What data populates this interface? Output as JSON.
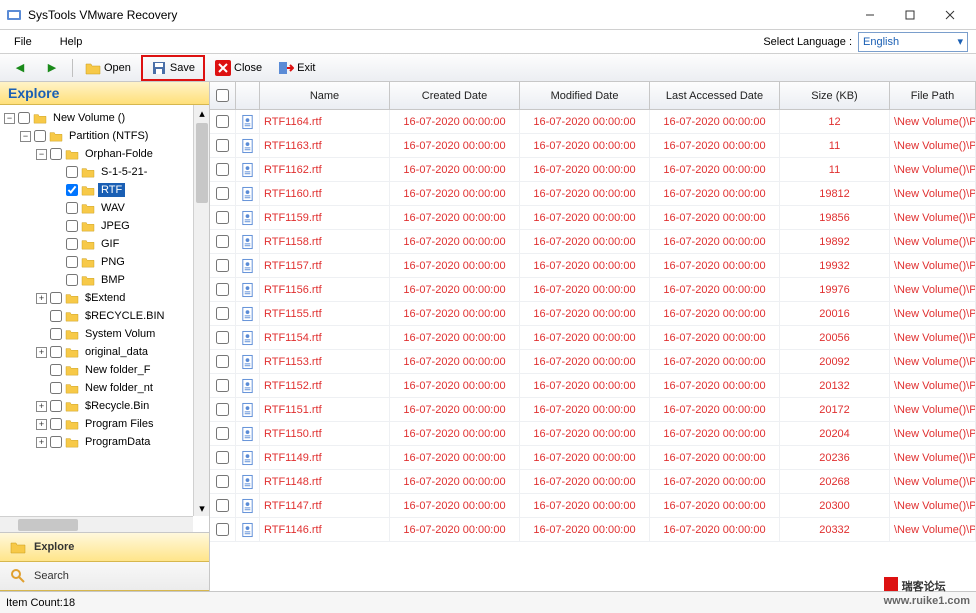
{
  "title": "SysTools VMware Recovery",
  "menu": {
    "file": "File",
    "help": "Help",
    "lang_label": "Select Language :",
    "lang_value": "English"
  },
  "toolbar": {
    "open": "Open",
    "save": "Save",
    "close": "Close",
    "exit": "Exit"
  },
  "explore_header": "Explore",
  "nav": {
    "explore": "Explore",
    "search": "Search"
  },
  "tree": {
    "root": "New Volume ()",
    "partition": "Partition (NTFS)",
    "orphan": "Orphan-Folde",
    "sid": "S-1-5-21-",
    "rtf": "RTF",
    "wav": "WAV",
    "jpeg": "JPEG",
    "gif": "GIF",
    "png": "PNG",
    "bmp": "BMP",
    "extend": "$Extend",
    "recycle": "$RECYCLE.BIN",
    "sysvol": "System Volum",
    "orig": "original_data",
    "nf1": "New folder_F",
    "nf2": "New folder_nt",
    "recbin": "$Recycle.Bin",
    "pf": "Program Files",
    "pd": "ProgramData"
  },
  "columns": {
    "name": "Name",
    "created": "Created Date",
    "modified": "Modified Date",
    "accessed": "Last Accessed Date",
    "size": "Size (KB)",
    "path": "File Path"
  },
  "rows": [
    {
      "name": "RTF1164.rtf",
      "created": "16-07-2020 00:00:00",
      "modified": "16-07-2020 00:00:00",
      "accessed": "16-07-2020 00:00:00",
      "size": "12",
      "path": "\\New Volume()\\Partiti..."
    },
    {
      "name": "RTF1163.rtf",
      "created": "16-07-2020 00:00:00",
      "modified": "16-07-2020 00:00:00",
      "accessed": "16-07-2020 00:00:00",
      "size": "11",
      "path": "\\New Volume()\\Partiti..."
    },
    {
      "name": "RTF1162.rtf",
      "created": "16-07-2020 00:00:00",
      "modified": "16-07-2020 00:00:00",
      "accessed": "16-07-2020 00:00:00",
      "size": "11",
      "path": "\\New Volume()\\Partiti..."
    },
    {
      "name": "RTF1160.rtf",
      "created": "16-07-2020 00:00:00",
      "modified": "16-07-2020 00:00:00",
      "accessed": "16-07-2020 00:00:00",
      "size": "19812",
      "path": "\\New Volume()\\Partiti..."
    },
    {
      "name": "RTF1159.rtf",
      "created": "16-07-2020 00:00:00",
      "modified": "16-07-2020 00:00:00",
      "accessed": "16-07-2020 00:00:00",
      "size": "19856",
      "path": "\\New Volume()\\Partiti..."
    },
    {
      "name": "RTF1158.rtf",
      "created": "16-07-2020 00:00:00",
      "modified": "16-07-2020 00:00:00",
      "accessed": "16-07-2020 00:00:00",
      "size": "19892",
      "path": "\\New Volume()\\Partiti..."
    },
    {
      "name": "RTF1157.rtf",
      "created": "16-07-2020 00:00:00",
      "modified": "16-07-2020 00:00:00",
      "accessed": "16-07-2020 00:00:00",
      "size": "19932",
      "path": "\\New Volume()\\Partiti..."
    },
    {
      "name": "RTF1156.rtf",
      "created": "16-07-2020 00:00:00",
      "modified": "16-07-2020 00:00:00",
      "accessed": "16-07-2020 00:00:00",
      "size": "19976",
      "path": "\\New Volume()\\Partiti..."
    },
    {
      "name": "RTF1155.rtf",
      "created": "16-07-2020 00:00:00",
      "modified": "16-07-2020 00:00:00",
      "accessed": "16-07-2020 00:00:00",
      "size": "20016",
      "path": "\\New Volume()\\Partiti..."
    },
    {
      "name": "RTF1154.rtf",
      "created": "16-07-2020 00:00:00",
      "modified": "16-07-2020 00:00:00",
      "accessed": "16-07-2020 00:00:00",
      "size": "20056",
      "path": "\\New Volume()\\Partiti..."
    },
    {
      "name": "RTF1153.rtf",
      "created": "16-07-2020 00:00:00",
      "modified": "16-07-2020 00:00:00",
      "accessed": "16-07-2020 00:00:00",
      "size": "20092",
      "path": "\\New Volume()\\Partiti..."
    },
    {
      "name": "RTF1152.rtf",
      "created": "16-07-2020 00:00:00",
      "modified": "16-07-2020 00:00:00",
      "accessed": "16-07-2020 00:00:00",
      "size": "20132",
      "path": "\\New Volume()\\Partiti..."
    },
    {
      "name": "RTF1151.rtf",
      "created": "16-07-2020 00:00:00",
      "modified": "16-07-2020 00:00:00",
      "accessed": "16-07-2020 00:00:00",
      "size": "20172",
      "path": "\\New Volume()\\Partiti..."
    },
    {
      "name": "RTF1150.rtf",
      "created": "16-07-2020 00:00:00",
      "modified": "16-07-2020 00:00:00",
      "accessed": "16-07-2020 00:00:00",
      "size": "20204",
      "path": "\\New Volume()\\Partiti..."
    },
    {
      "name": "RTF1149.rtf",
      "created": "16-07-2020 00:00:00",
      "modified": "16-07-2020 00:00:00",
      "accessed": "16-07-2020 00:00:00",
      "size": "20236",
      "path": "\\New Volume()\\Partiti..."
    },
    {
      "name": "RTF1148.rtf",
      "created": "16-07-2020 00:00:00",
      "modified": "16-07-2020 00:00:00",
      "accessed": "16-07-2020 00:00:00",
      "size": "20268",
      "path": "\\New Volume()\\Partiti..."
    },
    {
      "name": "RTF1147.rtf",
      "created": "16-07-2020 00:00:00",
      "modified": "16-07-2020 00:00:00",
      "accessed": "16-07-2020 00:00:00",
      "size": "20300",
      "path": "\\New Volume()\\Partiti..."
    },
    {
      "name": "RTF1146.rtf",
      "created": "16-07-2020 00:00:00",
      "modified": "16-07-2020 00:00:00",
      "accessed": "16-07-2020 00:00:00",
      "size": "20332",
      "path": "\\New Volume()\\Partiti..."
    }
  ],
  "status": "Item Count:18",
  "watermark": {
    "main": "瑞客论坛",
    "sub": "www.ruike1.com"
  }
}
